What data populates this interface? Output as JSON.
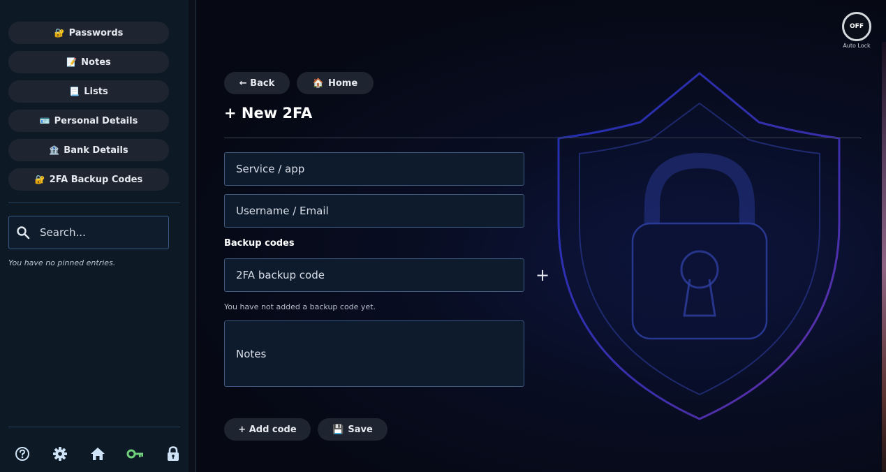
{
  "sidebar": {
    "nav": [
      {
        "label": "Passwords",
        "emoji": "🔐"
      },
      {
        "label": "Notes",
        "emoji": "📝"
      },
      {
        "label": "Lists",
        "emoji": "📃"
      },
      {
        "label": "Personal Details",
        "emoji": "🪪"
      },
      {
        "label": "Bank Details",
        "emoji": "🏦"
      },
      {
        "label": "2FA Backup Codes",
        "emoji": "🔐"
      }
    ],
    "search_placeholder": "Search...",
    "pinned_note": "You have no pinned entries.",
    "bottom_icons": [
      "help-icon",
      "gear-icon",
      "home-icon",
      "key-icon",
      "lock-icon"
    ],
    "colors": {
      "bg": "#0d1a26",
      "key_icon": "#6fcf7a",
      "icon": "#cfe3f7"
    }
  },
  "autolock": {
    "state": "OFF",
    "label": "Auto Lock"
  },
  "toolbar": {
    "back_label": "← Back",
    "home_label": "Home",
    "home_emoji": "🏠"
  },
  "form": {
    "title": "+ New 2FA",
    "service_placeholder": "Service / app",
    "username_placeholder": "Username / Email",
    "backup_codes_label": "Backup codes",
    "backup_code_placeholder": "2FA backup code",
    "add_symbol": "+",
    "no_codes_hint": "You have not added a backup code yet.",
    "notes_placeholder": "Notes"
  },
  "actions": {
    "add_code_label": "+ Add code",
    "save_label": "Save",
    "save_emoji": "💾"
  }
}
